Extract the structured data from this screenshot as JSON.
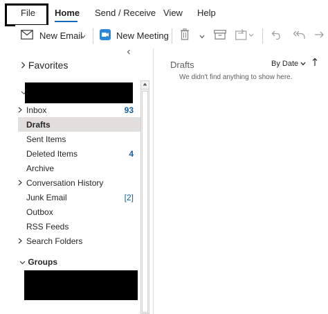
{
  "menu": {
    "file": "File",
    "home": "Home",
    "send_receive": "Send / Receive",
    "view": "View",
    "help": "Help"
  },
  "ribbon": {
    "new_email": "New Email",
    "new_meeting": "New Meeting",
    "icons": [
      "envelope-icon",
      "chevron-down-icon",
      "teams-meeting-icon",
      "trash-icon",
      "archive-icon",
      "move-folder-icon",
      "undo-icon",
      "reply-all-icon",
      "forward-icon"
    ]
  },
  "folders": {
    "favorites": "Favorites",
    "items": [
      {
        "name": "Inbox",
        "count": "93",
        "expandable": true
      },
      {
        "name": "Drafts",
        "count": "",
        "selected": true
      },
      {
        "name": "Sent Items",
        "count": ""
      },
      {
        "name": "Deleted Items",
        "count": "4"
      },
      {
        "name": "Archive",
        "count": ""
      },
      {
        "name": "Conversation History",
        "count": "",
        "expandable": true
      },
      {
        "name": "Junk Email",
        "count": "[2]"
      },
      {
        "name": "Outbox",
        "count": ""
      },
      {
        "name": "RSS Feeds",
        "count": ""
      },
      {
        "name": "Search Folders",
        "count": "",
        "expandable": true
      }
    ],
    "groups": "Groups"
  },
  "message_list": {
    "title": "Drafts",
    "sort_label": "By Date",
    "empty_text": "We didn't find anything to show here."
  },
  "colors": {
    "accent": "#0f6cbd",
    "count": "#115ea3",
    "selected_bg": "#e1dfdd",
    "highlight_box": "#000000"
  }
}
